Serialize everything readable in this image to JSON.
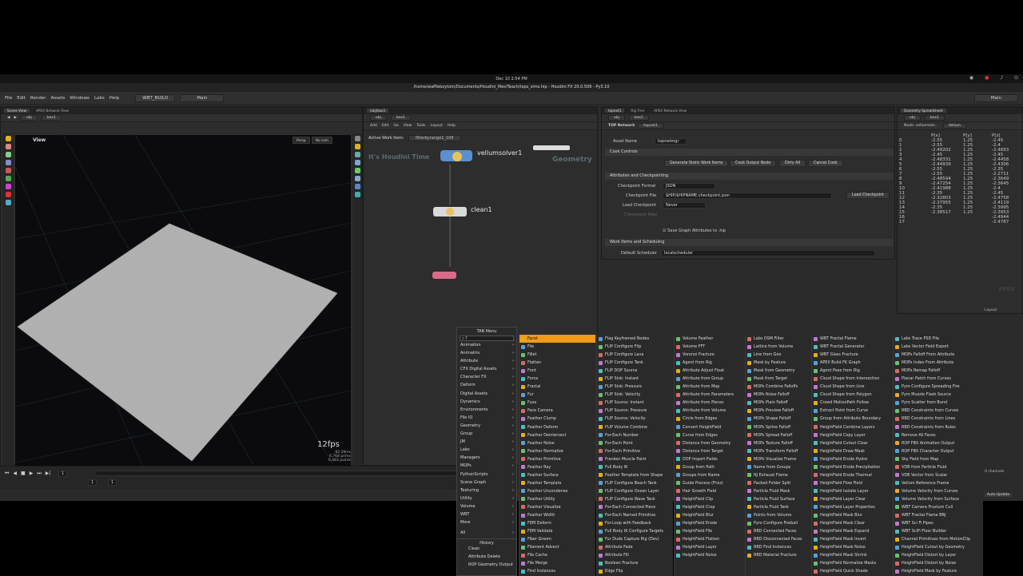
{
  "sysbar": {
    "clock": "Dec 10   2:54 PM"
  },
  "titlebar": {
    "title": "/home/waffleboytom/Documents/Houdini_files/Teach/tops_sims.hip - Houdini FX 20.0.506 - Py3.10"
  },
  "menu": [
    "File",
    "Edit",
    "Render",
    "Assets",
    "Windows",
    "Labs",
    "Help"
  ],
  "desktop": {
    "build": "WBT_BUILD",
    "main": "Main",
    "main_right": "Main"
  },
  "scene_view": {
    "tabs": [
      "Scene View",
      "APEX Network View"
    ],
    "path": [
      "obj",
      "box1"
    ],
    "label": "View",
    "persp": "Persp",
    "cam": "No cam",
    "fps": "12fps",
    "stats": [
      "82.29ms",
      "6,768  prims",
      "6,483  points"
    ]
  },
  "timeline": {
    "frame": "1",
    "start": "1",
    "end": "1"
  },
  "network": {
    "tabs": [
      "/obj/box1"
    ],
    "path": [
      "obj",
      "box1"
    ],
    "menu": [
      "Add",
      "Edit",
      "Go",
      "View",
      "Tools",
      "Layout",
      "Help"
    ],
    "active_work_item_label": "Active Work Item:",
    "active_work_item": "filterbyrange1_106",
    "nodes": {
      "vellum": "vellumsolver1",
      "clean": "clean1"
    },
    "watermark_left": "It's Houdini Time",
    "watermark_right": "Geometry"
  },
  "top_params": {
    "tabs": [
      "topnet1",
      "Rig Tree",
      "APEX Network View"
    ],
    "path": [
      "obj",
      "box1"
    ],
    "network_label": "TOP Network",
    "network_name": "topnet1",
    "asset_name_label": "Asset Name",
    "asset_name": "topnetmgr",
    "cook_controls": "Cook Controls",
    "buttons": [
      "Generate Static Work Items",
      "Cook Output Node",
      "Dirty All",
      "Cancel Cook"
    ],
    "attr_section": "Attributes and Checkpointing",
    "checkpoint_format_label": "Checkpoint Format",
    "checkpoint_format": "JSON",
    "checkpoint_file_label": "Checkpoint File",
    "checkpoint_file": "$HIP/$HIPNAME.checkpoint.json",
    "load_checkpoint_btn": "Load Checkpoint",
    "load_checkpoint_label": "Load Checkpoint",
    "load_checkpoint_value": "Never",
    "checkpoint_rate_label": "Checkpoint Rate",
    "save_graph": "Save Graph Attributes to .hip",
    "work_items_section": "Work Items and Scheduling",
    "default_scheduler_label": "Default Scheduler",
    "default_scheduler": "localscheduler"
  },
  "spreadsheet": {
    "tab": "Geometry Spreadsheet",
    "path": [
      "obj",
      "box1"
    ],
    "node": "Node: vellumsolv...",
    "view": "Vellum",
    "columns": [
      "",
      "P[x]",
      "P[y]",
      "P[z]"
    ],
    "rows": [
      [
        "0",
        "-2.55",
        "1.25",
        "-2.45"
      ],
      [
        "1",
        "-2.55",
        "1.25",
        "-2.4"
      ],
      [
        "2",
        "-2.49202",
        "1.25",
        "-2.4893"
      ],
      [
        "3",
        "-2.45",
        "1.25",
        "-2.45"
      ],
      [
        "4",
        "-2.48331",
        "1.25",
        "-2.4458"
      ],
      [
        "5",
        "-2.44939",
        "1.25",
        "-2.4306"
      ],
      [
        "6",
        "-2.55",
        "1.25",
        "-2.35"
      ],
      [
        "7",
        "-2.55",
        "1.25",
        "-2.2711"
      ],
      [
        "8",
        "-2.48594",
        "1.25",
        "-2.3649"
      ],
      [
        "9",
        "-2.47254",
        "1.25",
        "-2.3645"
      ],
      [
        "10",
        "-2.41988",
        "1.25",
        "-2.4"
      ],
      [
        "11",
        "-2.35",
        "1.25",
        "-2.45"
      ],
      [
        "12",
        "-2.32803",
        "1.25",
        "-2.4758"
      ],
      [
        "13",
        "-2.37955",
        "1.25",
        "-2.4119"
      ],
      [
        "14",
        "-2.35",
        "1.25",
        "-2.3995"
      ],
      [
        "15",
        "-2.38517",
        "1.25",
        "-2.3953"
      ],
      [
        "16",
        "",
        "",
        "-2.4944"
      ],
      [
        "17",
        "",
        "",
        "-2.4787"
      ]
    ],
    "apex": "APEX"
  },
  "tab_menu": {
    "title": "TAB Menu",
    "search": "f",
    "categories": [
      "Animation",
      "Animatrix",
      "Attribute",
      "CFX Digital Assets",
      "Character FX",
      "Deform",
      "Digital Assets",
      "Dynamics",
      "Environments",
      "File IO",
      "Geometry",
      "Group",
      "JM",
      "Labs",
      "Managers",
      "MOPs",
      "PythonScripts",
      "Scene Graph",
      "Texturing",
      "Utility",
      "Volume",
      "WBT",
      "More"
    ],
    "all": "All",
    "history_title": "History",
    "history": [
      "Clean",
      "Attribute Delete",
      "ROP Geometry Output"
    ]
  },
  "columns": [
    [
      "Facet",
      "File",
      "Fillet",
      "Flatten",
      "Font",
      "Force",
      "Fractal",
      "Fur",
      "Fuse",
      "Face Camera",
      "Feather Clump",
      "Feather Deform",
      "Feather Deintersect",
      "Feather Noise",
      "Feather Normalize",
      "Feather Primitive",
      "Feather Ray",
      "Feather Surface",
      "Feather Template",
      "Feather Uncondense",
      "Feather Utility",
      "Feather Visualize",
      "Feather Width",
      "FEM Deform",
      "FEM Validate",
      "Fiber Groom",
      "Filament Advect",
      "File Cache",
      "File Merge",
      "Find Instances"
    ],
    [
      "Flag Keyframed Nodes",
      "FLIP Configure Flip",
      "FLIP Configure Lava",
      "FLIP Configure Tank",
      "FLIP DOP Source",
      "FLIP Sink: Instant",
      "FLIP Sink: Pressure",
      "FLIP Sink: Velocity",
      "FLIP Source: Instant",
      "FLIP Source: Pressure",
      "FLIP Source: Velocity",
      "FLIP Volume Combine",
      "For-Each Number",
      "For-Each Point",
      "For-Each Primitive",
      "Franken Muscle Paint",
      "Full Body IK",
      "Feather Template from Shape",
      "FLIP Configure Beach Tank",
      "FLIP Configure Ocean Layer",
      "FLIP Configure Wave Tank",
      "For-Each Connected Piece",
      "For-Each Named Primitive",
      "For-Loop with Feedback",
      "Full Body IK Configure Targets",
      "Fur Dude Capture Rig (Dev)",
      "Attribute Fade",
      "Attribute Fill",
      "Boolean Fracture",
      "Edge Flip"
    ],
    [
      "Volume Feather",
      "Volume FFT",
      "Voronoi Fracture",
      "Agent from Rig",
      "Attribute Adjust Float",
      "Attribute from Group",
      "Attribute from Map",
      "Attribute from Parameters",
      "Attribute from Pieces",
      "Attribute from Volume",
      "Circle from Edges",
      "Convert HeightField",
      "Curve from Edges",
      "Distance from Geometry",
      "Distance from Target",
      "DOP Import Fields",
      "Group from Path",
      "Groups from Name",
      "Guide Process (Frizz)",
      "Hair Growth Field",
      "HeightField Clip",
      "HeightField Crop",
      "HeightField Blur",
      "HeightField Erode",
      "HeightField File",
      "HeightField Flatten",
      "HeightField Layer",
      "HeightField Noise"
    ],
    [
      "Labs OSM Filter",
      "Lattice from Volume",
      "Line from Geo",
      "Mask by Feature",
      "Mask from Geometry",
      "Mask from Target",
      "MOPs Combine Falloffs",
      "MOPs Noise Falloff",
      "MOPs Plain Falloff",
      "MOPs Preview Falloff",
      "MOPs Shape Falloff",
      "MOPs Spline Falloff",
      "MOPs Spread Falloff",
      "MOPs Texture Falloff",
      "MOPs Transform Falloff",
      "MOPs Visualize Frame",
      "Name from Groups",
      "NJ Exhaust Flame",
      "Packed Folder Split",
      "Particle Fluid Mask",
      "Particle Fluid Surface",
      "Particle Fluid Tank",
      "Points from Volume",
      "Pyro Configure Fireball",
      "RBD Connected Faces",
      "RBD Disconnected Faces",
      "RBD Find Instances",
      "RBD Material Fracture"
    ],
    [
      "WBT Fractal Flame",
      "WBT Fractal Generator",
      "WBT Glass Fracture",
      "APEX Build FK Graph",
      "Agent Pose from Rig",
      "Cloud Shape from Intersection",
      "Cloud Shape from Line",
      "Cloud Shape from Polygon",
      "Crowd MotionPath Follow",
      "Extract Point from Curve",
      "Group from Attribute Boundary",
      "HeightField Combine Layers",
      "HeightField Copy Layer",
      "HeightField Cutout Clear",
      "HeightField Draw Mask",
      "HeightField Erode Hydro",
      "HeightField Erode Precipitation",
      "HeightField Erode Thermal",
      "HeightField Flow Field",
      "HeightField Isolate Layer",
      "HeightField Layer Clear",
      "HeightField Layer Properties",
      "HeightField Mask Blur",
      "HeightField Mask Clear",
      "HeightField Mask Expand",
      "HeightField Mask Invert",
      "HeightField Mask Noise",
      "HeightField Mask Shrink",
      "HeightField Normalize Masks",
      "HeightField Quick Shade"
    ],
    [
      "Labs Trace PSD File",
      "Labs Vector Field Export",
      "MOPs Falloff From Attribute",
      "MOPs Index From Attribute",
      "MOPs Remap Falloff",
      "Planar Patch from Curves",
      "Pyro Configure Spreading Fire",
      "Pyro Muzzle Flash Source",
      "Pyro Scatter from Burst",
      "RBD Constraints from Curves",
      "RBD Constraints from Lines",
      "RBD Constraints from Rules",
      "Remove All Faces",
      "ROP FBX Animation Output",
      "ROP FBX Character Output",
      "Sky Field from Map",
      "VDB from Particle Fluid",
      "VDB Vector from Scalar",
      "Vellum Reference Frame",
      "Volume Velocity from Curves",
      "Volume Velocity from Surface",
      "WBT Camera Frustum Cull",
      "WBT Fractal Flame BRJ",
      "WBT Sci Fi Pipes",
      "WBT SciFi Floor Builder",
      "Channel Primitives from MotionClip",
      "HeightField Cutout by Geometry",
      "HeightField Distort by Layer",
      "HeightField Distort by Noise",
      "HeightField Mask by Feature"
    ]
  ],
  "status": {
    "channels": "0 channels",
    "auto_update": "Auto Update",
    "layout": "Layout"
  },
  "colors": {
    "selected": "#f09a1a",
    "background": "#2b2b2b",
    "viewport": "#0b0b0e"
  }
}
